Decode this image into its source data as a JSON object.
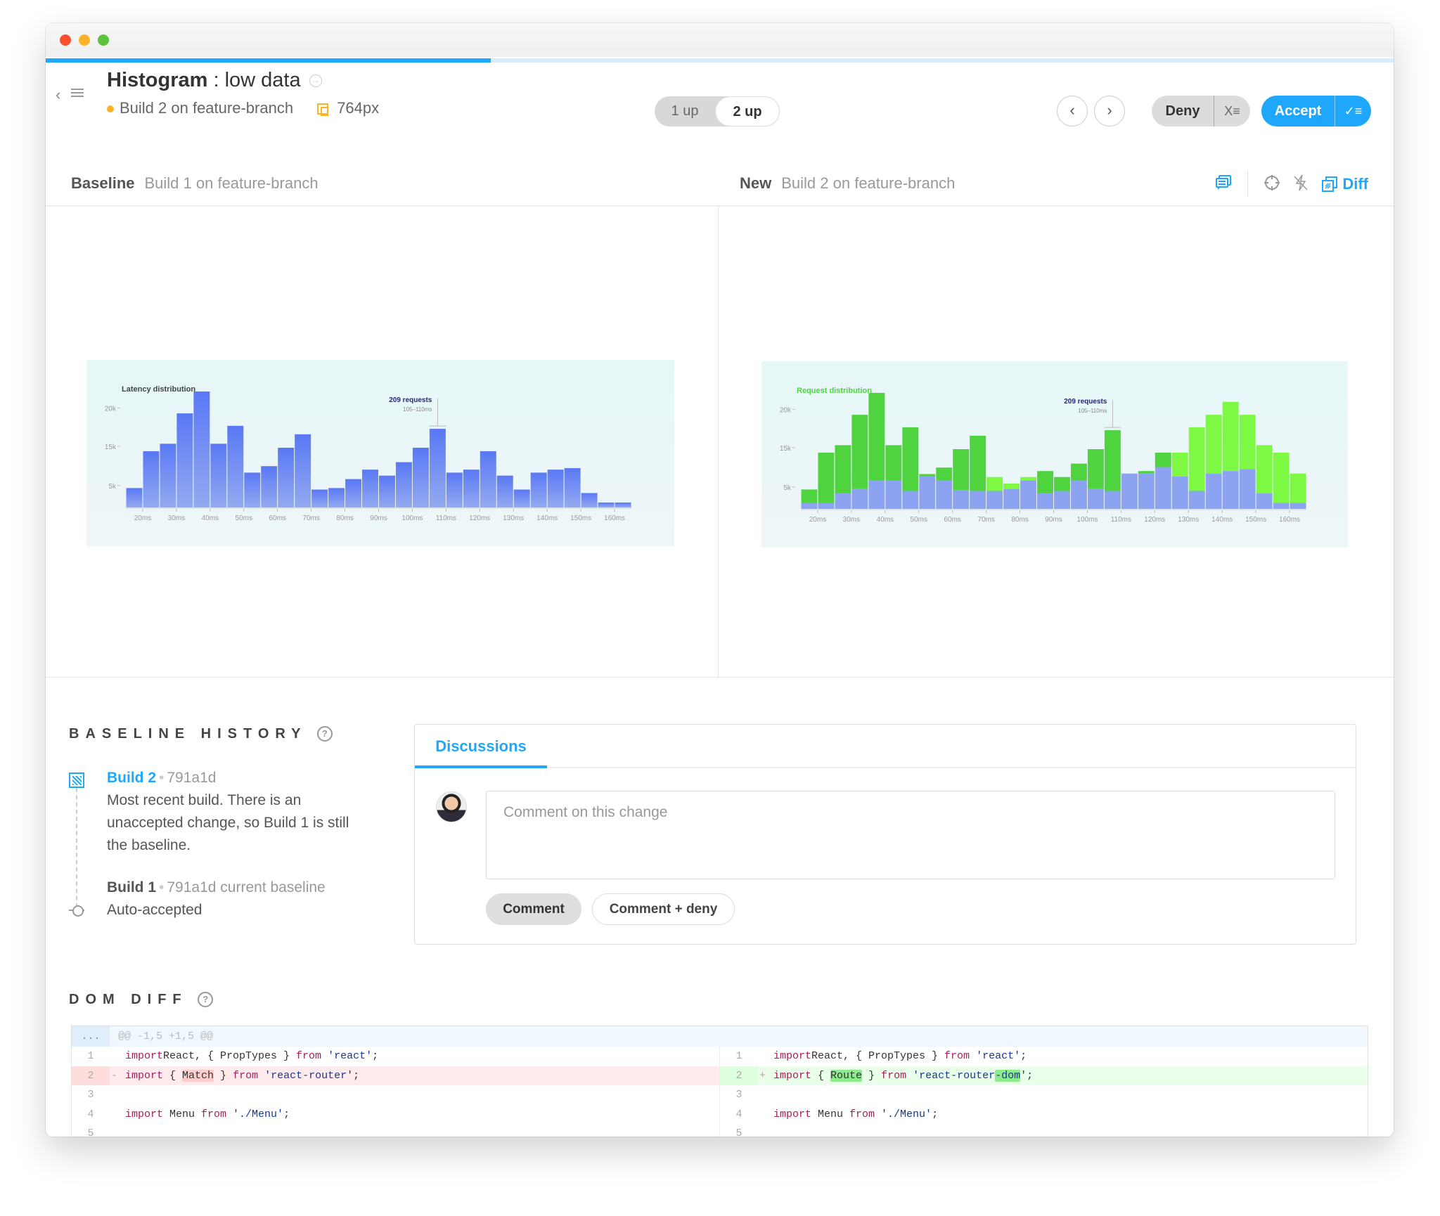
{
  "window": {
    "progress_percent": 33
  },
  "header": {
    "back_icon": "chevron-left-icon",
    "list_icon": "list-icon",
    "title_bold": "Histogram",
    "title_separator": " : ",
    "title_rest": "low data",
    "title_link_icon": "circle-arrow-icon",
    "build_label": "Build 2 on feature-branch",
    "build_status_color": "#fdb227",
    "viewport_label": "764px",
    "view_toggle": {
      "options": [
        "1 up",
        "2 up"
      ],
      "selected": "2 up"
    },
    "prev_label": "‹",
    "next_label": "›",
    "deny_label": "Deny",
    "deny_menu_icon": "X≡",
    "accept_label": "Accept",
    "accept_menu_icon": "✓≡",
    "accent_color": "#1ea7fd"
  },
  "panes": {
    "baseline_label": "Baseline",
    "baseline_build": "Build 1 on feature-branch",
    "new_label": "New",
    "new_build": "Build 2 on feature-branch",
    "tools": {
      "comments_icon": "comments-icon",
      "crosshair_icon": "crosshair-icon",
      "strobe_off_icon": "strobe-off-icon",
      "diff_icon": "diff-icon",
      "diff_label": "Diff"
    }
  },
  "chart_data": [
    {
      "type": "bar",
      "name": "baseline",
      "title": "Latency distribution",
      "xlabel": "",
      "ylabel": "",
      "x_tick_labels": [
        "20ms",
        "30ms",
        "40ms",
        "50ms",
        "60ms",
        "70ms",
        "80ms",
        "90ms",
        "100ms",
        "110ms",
        "120ms",
        "130ms",
        "140ms",
        "150ms",
        "160ms"
      ],
      "y_tick_labels": [
        {
          "label": "20k",
          "value": 20
        },
        {
          "label": "15k",
          "value": 15
        },
        {
          "label": "5k",
          "value": 5
        }
      ],
      "y_tick_positions_k": [
        20,
        12.3,
        4.4
      ],
      "ylim": [
        0,
        24
      ],
      "bin_start_ms": 15,
      "bin_width_ms": 5,
      "values_k": [
        3.9,
        11.3,
        12.8,
        18.9,
        23.3,
        12.8,
        16.4,
        7.0,
        8.3,
        12.0,
        14.7,
        3.6,
        3.9,
        5.7,
        7.6,
        6.4,
        9.1,
        12.0,
        15.8,
        7.0,
        7.6,
        11.3,
        6.4,
        3.6,
        7.0,
        7.6,
        7.9,
        2.9,
        1.0,
        1.0
      ],
      "bar_color": "#6b8af0",
      "annotation": {
        "title": "209 requests",
        "subtitle": "105–110ms",
        "bin_index": 18
      }
    },
    {
      "type": "bar",
      "name": "new-diff",
      "title": "Request distribution",
      "title_overlap": "Latency distribution",
      "x_tick_labels": [
        "20ms",
        "30ms",
        "40ms",
        "50ms",
        "60ms",
        "70ms",
        "80ms",
        "90ms",
        "100ms",
        "110ms",
        "120ms",
        "130ms",
        "140ms",
        "150ms",
        "160ms"
      ],
      "y_tick_labels": [
        {
          "label": "20k",
          "value": 20
        },
        {
          "label": "15k",
          "value": 15
        },
        {
          "label": "5k",
          "value": 5
        }
      ],
      "y_tick_positions_k": [
        20,
        12.3,
        4.4
      ],
      "ylim": [
        0,
        24
      ],
      "bin_start_ms": 15,
      "bin_width_ms": 5,
      "series": [
        {
          "name": "new",
          "color": "#8ba3f0",
          "values_k": [
            1.2,
            1.2,
            3.1,
            4.0,
            5.7,
            5.7,
            3.6,
            6.5,
            5.7,
            3.8,
            3.6,
            3.6,
            4.0,
            5.7,
            3.1,
            3.6,
            5.7,
            4.0,
            3.6,
            7.1,
            7.1,
            8.4,
            6.5,
            3.6,
            7.1,
            7.6,
            8.0,
            3.1,
            1.2,
            1.2
          ]
        },
        {
          "name": "diff-top",
          "values_k": [
            3.9,
            11.3,
            12.8,
            18.9,
            23.3,
            12.8,
            16.4,
            7.0,
            8.3,
            12.0,
            14.7,
            6.4,
            5.1,
            6.4,
            7.6,
            6.4,
            9.1,
            12.0,
            15.8,
            7.1,
            7.6,
            11.3,
            11.3,
            16.4,
            18.9,
            21.5,
            18.9,
            12.8,
            11.3,
            7.1
          ]
        }
      ],
      "diff_colors": {
        "changed_removed": "#4fd43f",
        "changed_added": "#7df944"
      },
      "diff_kind": [
        "rem",
        "rem",
        "rem",
        "rem",
        "rem",
        "rem",
        "rem",
        "rem",
        "rem",
        "rem",
        "rem",
        "add",
        "add",
        "add",
        "rem",
        "rem",
        "rem",
        "rem",
        "rem",
        "none",
        "rem",
        "rem",
        "add",
        "add",
        "add",
        "add",
        "add",
        "add",
        "add",
        "add"
      ],
      "annotation": {
        "title": "209 requests",
        "subtitle": "105–110ms",
        "bin_index": 18
      }
    }
  ],
  "history": {
    "title": "BASELINE HISTORY",
    "help_icon": "?",
    "items": [
      {
        "name": "Build 2",
        "commit": "791a1d",
        "extra": "",
        "description_lines": [
          "Most recent build. There is an",
          "unaccepted change, so Build 1 is still",
          "the baseline."
        ]
      },
      {
        "name": "Build 1",
        "commit": "791a1d",
        "extra": "current baseline",
        "description_lines": [
          "Auto-accepted"
        ]
      }
    ]
  },
  "discussions": {
    "tab_label": "Discussions",
    "placeholder": "Comment on this change",
    "value": "",
    "comment_button": "Comment",
    "comment_deny_button": "Comment + deny"
  },
  "dom_diff": {
    "title": "DOM DIFF",
    "help_icon": "?",
    "hunk_dots": "...",
    "hunk_header": "@@ -1,5 +1,5 @@",
    "left": [
      {
        "ln": "1",
        "marker": "",
        "type": "ctx",
        "tokens": [
          [
            "kw",
            "import"
          ],
          [
            "",
            "React, { PropTypes } "
          ],
          [
            "kw",
            "from"
          ],
          [
            "",
            ""
          ],
          [
            "str",
            " 'react'"
          ],
          [
            "",
            ";"
          ]
        ]
      },
      {
        "ln": "2",
        "marker": "-",
        "type": "del",
        "tokens": [
          [
            "kw",
            "import"
          ],
          [
            "",
            " { "
          ],
          [
            "hl-del",
            "Match"
          ],
          [
            "",
            " } "
          ],
          [
            "kw",
            "from"
          ],
          [
            "str",
            " 'react-router'"
          ],
          [
            "",
            ";"
          ]
        ]
      },
      {
        "ln": "3",
        "marker": "",
        "type": "ctx",
        "tokens": []
      },
      {
        "ln": "4",
        "marker": "",
        "type": "ctx",
        "tokens": [
          [
            "kw",
            "import"
          ],
          [
            "",
            " Menu "
          ],
          [
            "kw",
            "from"
          ],
          [
            "str",
            " './Menu'"
          ],
          [
            "",
            ";"
          ]
        ]
      },
      {
        "ln": "5",
        "marker": "",
        "type": "ctx",
        "tokens": []
      }
    ],
    "right": [
      {
        "ln": "1",
        "marker": "",
        "type": "ctx",
        "tokens": [
          [
            "kw",
            "import"
          ],
          [
            "",
            "React, { PropTypes } "
          ],
          [
            "kw",
            "from"
          ],
          [
            "",
            ""
          ],
          [
            "str",
            " 'react'"
          ],
          [
            "",
            ";"
          ]
        ]
      },
      {
        "ln": "2",
        "marker": "+",
        "type": "add",
        "tokens": [
          [
            "kw",
            "import"
          ],
          [
            "",
            " { "
          ],
          [
            "hl-add",
            "Route"
          ],
          [
            "",
            " } "
          ],
          [
            "kw",
            "from"
          ],
          [
            "str",
            " 'react-router"
          ],
          [
            "hl-add str",
            "-dom"
          ],
          [
            "str",
            "'"
          ],
          [
            "",
            ";"
          ]
        ]
      },
      {
        "ln": "3",
        "marker": "",
        "type": "ctx",
        "tokens": []
      },
      {
        "ln": "4",
        "marker": "",
        "type": "ctx",
        "tokens": [
          [
            "kw",
            "import"
          ],
          [
            "",
            " Menu "
          ],
          [
            "kw",
            "from"
          ],
          [
            "str",
            " './Menu'"
          ],
          [
            "",
            ";"
          ]
        ]
      },
      {
        "ln": "5",
        "marker": "",
        "type": "ctx",
        "tokens": []
      }
    ]
  }
}
